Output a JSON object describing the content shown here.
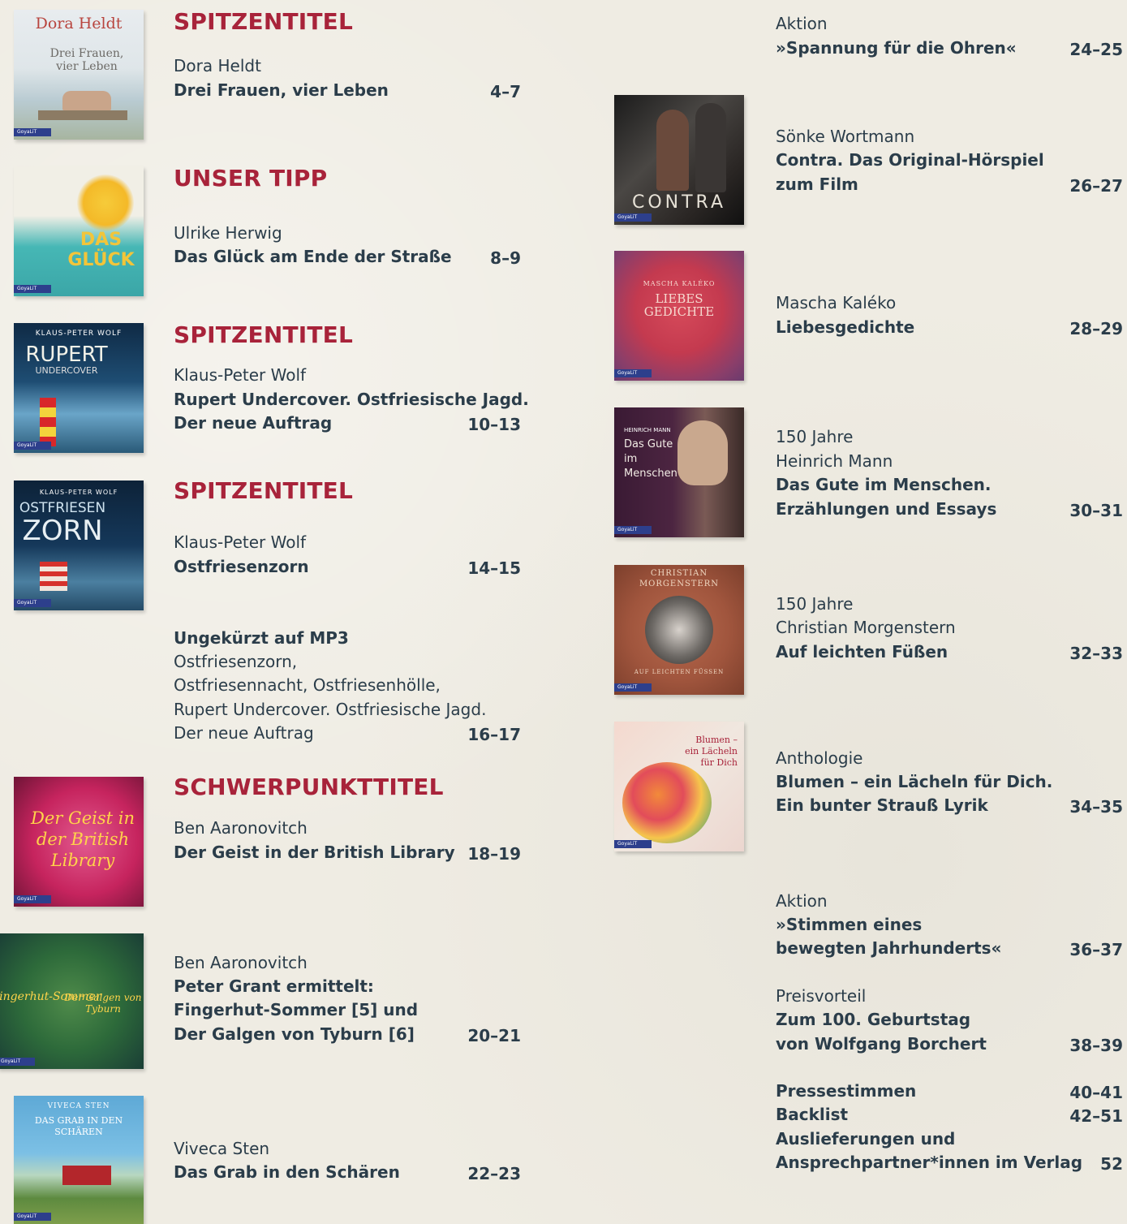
{
  "left": {
    "sec1": {
      "heading": "SPITZENTITEL",
      "author": "Dora Heldt",
      "title": "Drei Frauen, vier Leben",
      "pages": "4–7"
    },
    "sec2": {
      "heading": "UNSER TIPP",
      "author": "Ulrike Herwig",
      "title": "Das Glück am Ende der Straße",
      "pages": "8–9"
    },
    "sec3": {
      "heading": "SPITZENTITEL",
      "author": "Klaus-Peter Wolf",
      "title1": "Rupert Undercover. Ostfriesische Jagd.",
      "title2": "Der neue Auftrag",
      "pages": "10–13"
    },
    "sec4": {
      "heading": "SPITZENTITEL",
      "author": "Klaus-Peter Wolf",
      "title": "Ostfriesenzorn",
      "pages": "14–15"
    },
    "sec5": {
      "title": "Ungekürzt auf MP3",
      "l1": "Ostfriesenzorn,",
      "l2": "Ostfriesennacht, Ostfriesenhölle,",
      "l3": "Rupert Undercover. Ostfriesische Jagd.",
      "l4": "Der neue Auftrag",
      "pages": "16–17"
    },
    "sec6": {
      "heading": "SCHWERPUNKTTITEL",
      "author": "Ben Aaronovitch",
      "title": "Der Geist in der British Library",
      "pages": "18–19"
    },
    "sec7": {
      "author": "Ben Aaronovitch",
      "t1": "Peter Grant ermittelt:",
      "t2": "Fingerhut-Sommer [5] und",
      "t3": "Der Galgen von Tyburn [6]",
      "pages": "20–21"
    },
    "sec8": {
      "author": "Viveca Sten",
      "title": "Das Grab in den Schären",
      "pages": "22–23"
    }
  },
  "right": {
    "r1": {
      "label": "Aktion",
      "title": "»Spannung für die Ohren«",
      "pages": "24–25"
    },
    "r2": {
      "author": "Sönke Wortmann",
      "t1": "Contra. Das Original-Hörspiel",
      "t2": "zum Film",
      "pages": "26–27"
    },
    "r3": {
      "author": "Mascha Kaléko",
      "title": "Liebesgedichte",
      "pages": "28–29"
    },
    "r4": {
      "l1": "150 Jahre",
      "l2": "Heinrich Mann",
      "t1": "Das Gute im Menschen.",
      "t2": "Erzählungen und Essays",
      "pages": "30–31"
    },
    "r5": {
      "l1": "150 Jahre",
      "l2": "Christian Morgenstern",
      "title": "Auf leichten Füßen",
      "pages": "32–33"
    },
    "r6": {
      "label": "Anthologie",
      "t1": "Blumen – ein Lächeln für Dich.",
      "t2": "Ein bunter Strauß Lyrik",
      "pages": "34–35"
    },
    "r7": {
      "label": "Aktion",
      "t1": "»Stimmen eines",
      "t2": "bewegten Jahrhunderts«",
      "pages": "36–37"
    },
    "r8": {
      "label": "Preisvorteil",
      "t1": "Zum 100. Geburtstag",
      "t2": "von Wolfgang Borchert",
      "pages": "38–39"
    },
    "r9": {
      "presse": "Pressestimmen",
      "presse_pages": "40–41",
      "backlist": "Backlist",
      "backlist_pages": "42–51",
      "aus1": "Auslieferungen und",
      "aus2": "Ansprechpartner*innen im Verlag",
      "aus_pages": "52"
    }
  },
  "covers": {
    "heldt": {
      "author": "Dora Heldt",
      "title": "Drei Frauen, vier Leben"
    },
    "herwig": {
      "title": "DAS GLÜCK"
    },
    "rupert": {
      "author": "KLAUS-PETER WOLF",
      "title": "RUPERT",
      "sub": "UNDERCOVER"
    },
    "zorn": {
      "author": "KLAUS-PETER WOLF",
      "title1": "OSTFRIESEN",
      "title2": "ZORN"
    },
    "contra": {
      "title": "CONTRA"
    },
    "kaleko": {
      "author": "MASCHA KALÉKO",
      "title1": "LIEBES",
      "title2": "GEDICHTE"
    },
    "mann": {
      "author": "HEINRICH MANN",
      "t1": "Das Gute",
      "t2": "im",
      "t3": "Menschen"
    },
    "morgenstern": {
      "author": "CHRISTIAN MORGENSTERN",
      "title": "AUF LEICHTEN FÜSSEN"
    },
    "blumen": {
      "t1": "Blumen –",
      "t2": "ein Lächeln",
      "t3": "für Dich"
    },
    "geist": {
      "title": "Der Geist in der British Library"
    },
    "fingerhut": {
      "t1": "Fingerhut-Sommer",
      "t2": "Der Galgen von Tyburn"
    },
    "sten": {
      "author": "VIVECA STEN",
      "title": "DAS GRAB IN DEN SCHÄREN"
    },
    "logo_text": "GoyaLiT"
  },
  "colors": {
    "accent": "#a8233a",
    "text": "#2b3d4a",
    "background": "#efece3"
  }
}
